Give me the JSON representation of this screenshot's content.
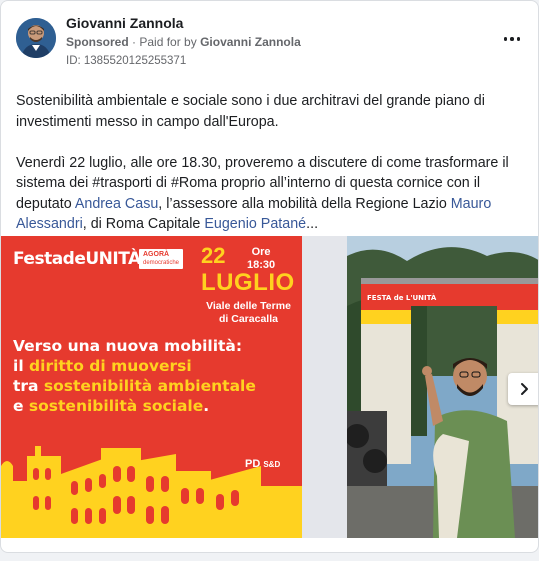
{
  "post": {
    "author": "Giovanni Zannola",
    "sponsored_label": "Sponsored",
    "dot": "·",
    "paid_for_prefix": "Paid for by",
    "paid_for_name": "Giovanni Zannola",
    "ad_id": "ID: 1385520125255371",
    "more_icon": "more-horizontal-icon"
  },
  "body": {
    "p1": "Sostenibilità ambientale e sociale sono i due architravi del grande piano di investimenti messo in campo dall'Europa.",
    "p2_a": "Venerdì 22 luglio, alle ore 18.30, proveremo a discutere di come trasformare il sistema dei #trasporti di #Roma proprio all’interno di questa cornice con il deputato ",
    "link_casu": "Andrea Casu",
    "p2_b": ", l’assessore alla mobilità della Regione Lazio ",
    "link_alessandri": "Mauro Alessandri",
    "p2_c": ", di Roma Capitale ",
    "link_patane": "Eugenio Patané",
    "ellipsis": "..."
  },
  "slide1": {
    "logo": "FestadeUNITÀ",
    "agora_title": "AGORÀ",
    "agora_sub": "democratiche",
    "day": "22",
    "ore_label": "Ore",
    "time": "18:30",
    "month": "LUGLIO",
    "venue": "Viale delle Terme di Caracalla",
    "headline_1": "Verso una nuova mobilità:",
    "headline_2a": "il ",
    "headline_2b": "diritto di muoversi",
    "headline_3a": "tra ",
    "headline_3b": "sostenibilità ambientale",
    "headline_4a": "e ",
    "headline_4b": "sostenibilità sociale",
    "headline_4c": ".",
    "pd_logo": "PD",
    "pd_sub": "S&D"
  },
  "slide2": {
    "gate_sign": "FESTA de L'UNITÀ"
  },
  "colors": {
    "accent_red": "#e63a2e",
    "accent_yellow": "#ffd21f",
    "link_blue": "#385898"
  }
}
